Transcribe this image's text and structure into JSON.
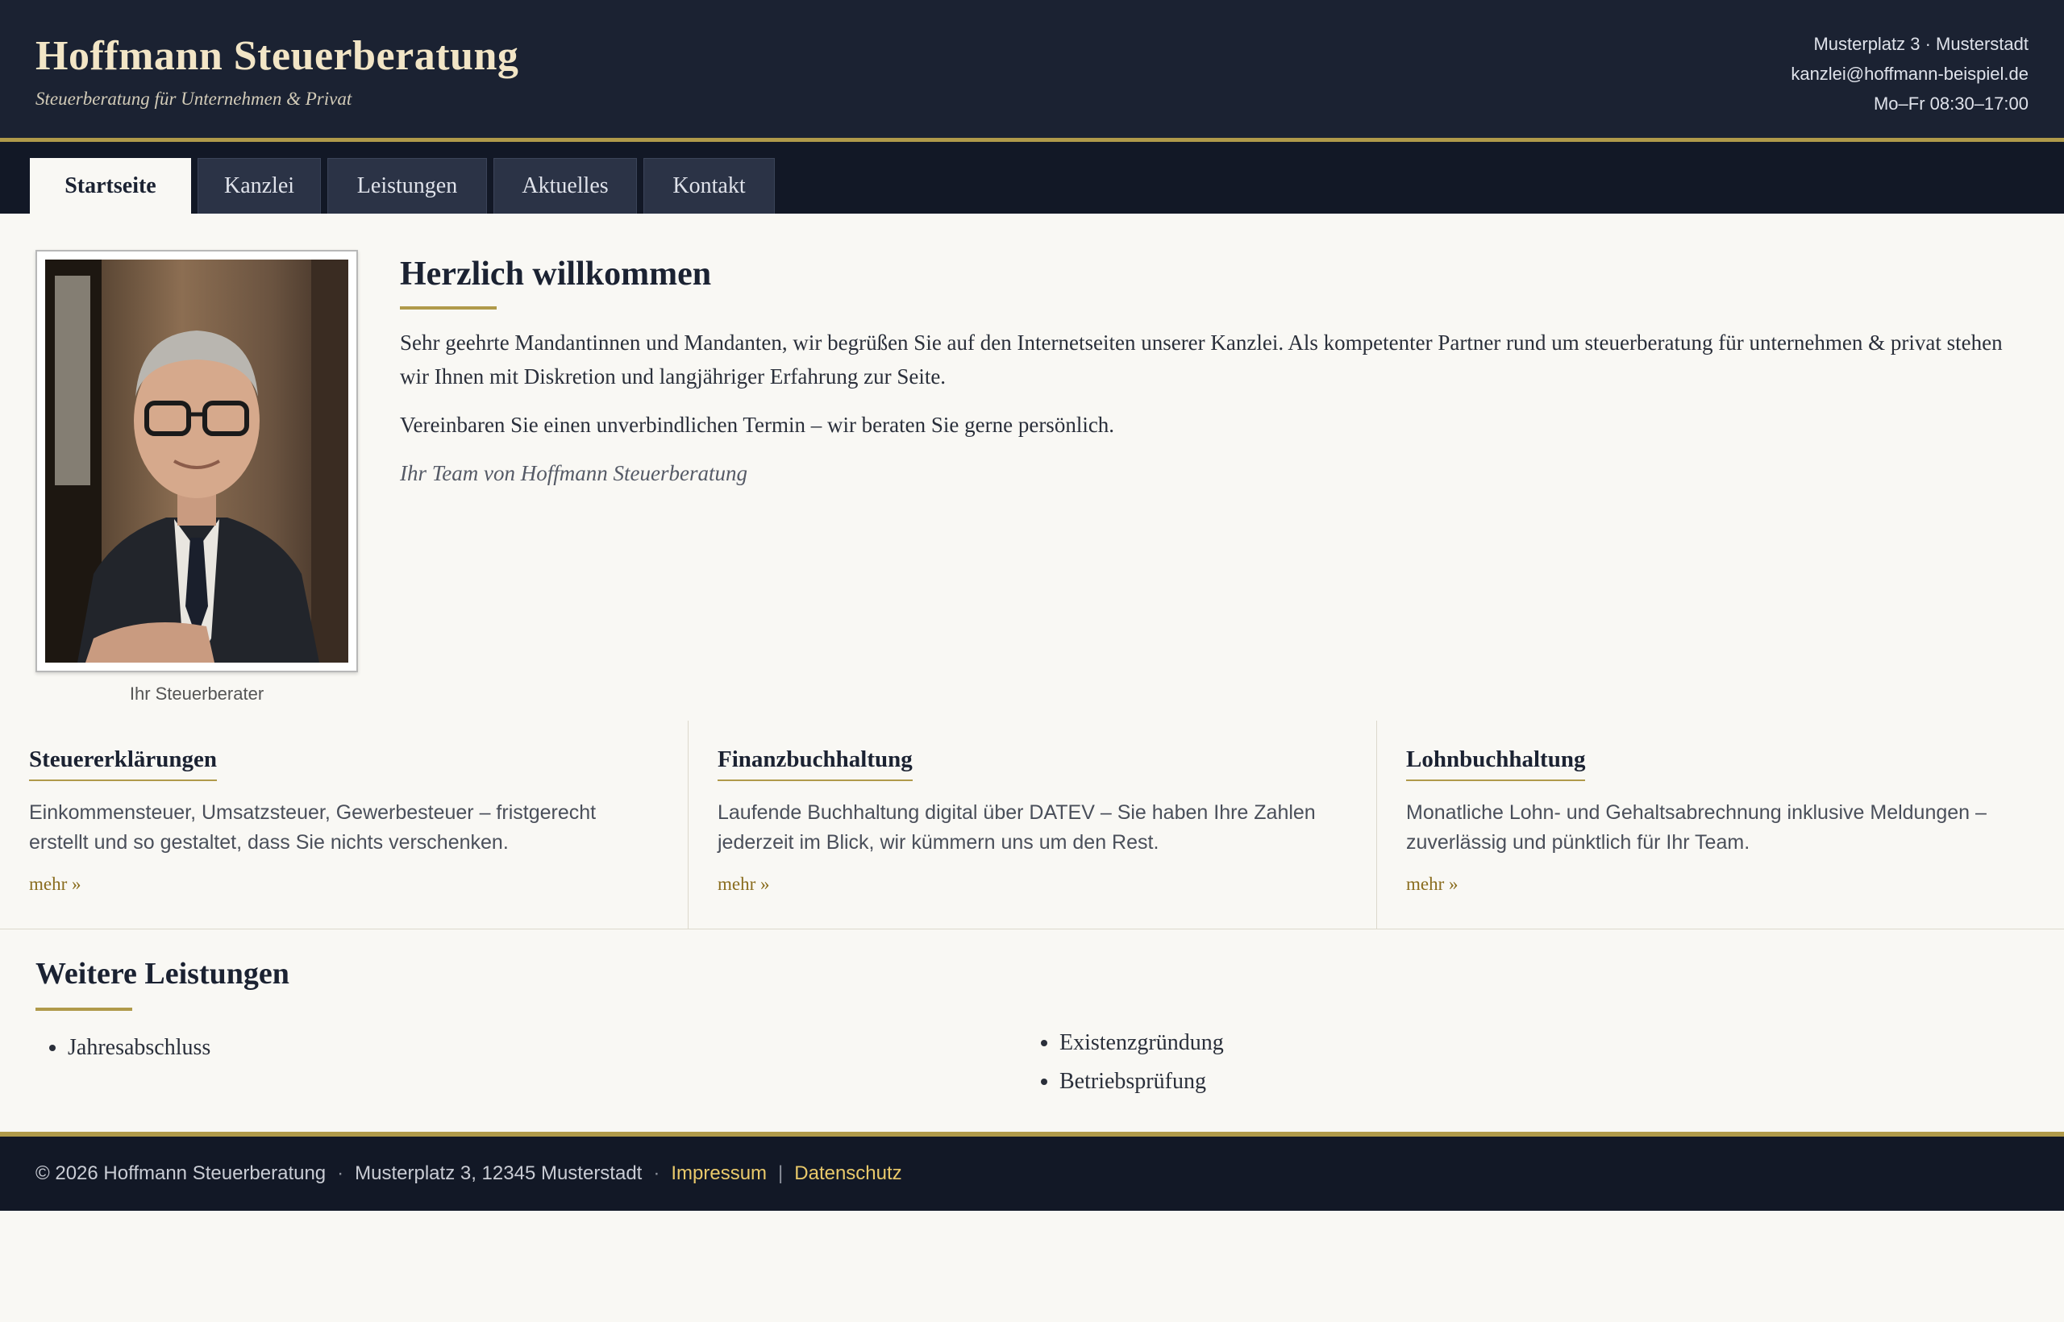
{
  "header": {
    "title": "Hoffmann Steuerberatung",
    "tagline": "Steuerberatung für Unternehmen & Privat",
    "address": "Musterplatz 3 · Musterstadt",
    "email": "kanzlei@hoffmann-beispiel.de",
    "hours": "Mo–Fr 08:30–17:00"
  },
  "nav": {
    "tabs": [
      {
        "label": "Startseite",
        "active": true
      },
      {
        "label": "Kanzlei"
      },
      {
        "label": "Leistungen"
      },
      {
        "label": "Aktuelles"
      },
      {
        "label": "Kontakt"
      }
    ]
  },
  "welcome": {
    "portrait_caption": "Ihr Steuerberater",
    "title": "Herzlich willkommen",
    "paragraph1": "Sehr geehrte Mandantinnen und Mandanten, wir begrüßen Sie auf den Internetseiten unserer Kanzlei. Als kompetenter Partner rund um steuerberatung für unternehmen & privat stehen wir Ihnen mit Diskretion und langjähriger Erfahrung zur Seite.",
    "paragraph2": "Vereinbaren Sie einen unverbindlichen Termin – wir beraten Sie gerne persönlich.",
    "signature": "Ihr Team von Hoffmann Steuerberatung"
  },
  "services": [
    {
      "title": "Steuererklärungen",
      "text": "Einkommensteuer, Umsatzsteuer, Gewerbesteuer – fristgerecht erstellt und so gestaltet, dass Sie nichts verschenken.",
      "more": "mehr »"
    },
    {
      "title": "Finanzbuchhaltung",
      "text": "Laufende Buchhaltung digital über DATEV – Sie haben Ihre Zahlen jederzeit im Blick, wir kümmern uns um den Rest.",
      "more": "mehr »"
    },
    {
      "title": "Lohnbuchhaltung",
      "text": "Monatliche Lohn- und Gehaltsabrechnung inklusive Meldungen – zuverlässig und pünktlich für Ihr Team.",
      "more": "mehr »"
    }
  ],
  "further": {
    "title": "Weitere Leistungen",
    "left": [
      "Jahresabschluss"
    ],
    "right": [
      "Existenzgründung",
      "Betriebsprüfung"
    ]
  },
  "footer": {
    "copyright": "© 2026 Hoffmann Steuerberatung",
    "address": "Musterplatz 3, 12345 Musterstadt",
    "sep_dot": "·",
    "sep_bar": "|",
    "impressum": "Impressum",
    "datenschutz": "Datenschutz"
  },
  "colors": {
    "header_bg": "#1b2232",
    "accent_gold": "#b09a4a",
    "link_gold": "#e9c96a",
    "page_bg": "#f9f8f4"
  }
}
